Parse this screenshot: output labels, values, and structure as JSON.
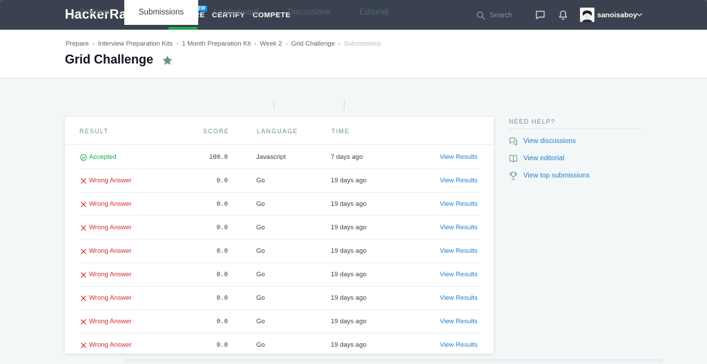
{
  "nav": {
    "logo": "HackerRank",
    "links": [
      "PREPARE",
      "CERTIFY",
      "COMPETE"
    ],
    "new_badge": "NEW",
    "search_placeholder": "Search",
    "username": "sanoisaboy"
  },
  "breadcrumb": [
    "Prepare",
    "Interview Preparation Kits",
    "1 Month Preparation Kit",
    "Week 2",
    "Grid Challenge",
    "Submissions"
  ],
  "page_title": "Grid Challenge",
  "tabs": [
    "Problem",
    "Submissions",
    "Leaderboard",
    "Discussions",
    "Editorial"
  ],
  "table": {
    "headers": [
      "RESULT",
      "SCORE",
      "LANGUAGE",
      "TIME"
    ],
    "rows": [
      {
        "result": "Accepted",
        "score": "100.0",
        "language": "Javascript",
        "time": "7 days ago",
        "action": "View Results"
      },
      {
        "result": "Wrong Answer",
        "score": "0.0",
        "language": "Go",
        "time": "19 days ago",
        "action": "View Results"
      },
      {
        "result": "Wrong Answer",
        "score": "0.0",
        "language": "Go",
        "time": "19 days ago",
        "action": "View Results"
      },
      {
        "result": "Wrong Answer",
        "score": "0.0",
        "language": "Go",
        "time": "19 days ago",
        "action": "View Results"
      },
      {
        "result": "Wrong Answer",
        "score": "0.0",
        "language": "Go",
        "time": "19 days ago",
        "action": "View Results"
      },
      {
        "result": "Wrong Answer",
        "score": "0.0",
        "language": "Go",
        "time": "19 days ago",
        "action": "View Results"
      },
      {
        "result": "Wrong Answer",
        "score": "0.0",
        "language": "Go",
        "time": "19 days ago",
        "action": "View Results"
      },
      {
        "result": "Wrong Answer",
        "score": "0.0",
        "language": "Go",
        "time": "19 days ago",
        "action": "View Results"
      },
      {
        "result": "Wrong Answer",
        "score": "0.0",
        "language": "Go",
        "time": "19 days ago",
        "action": "View Results"
      }
    ]
  },
  "help": {
    "title": "NEED HELP?",
    "items": [
      "View discussions",
      "View editorial",
      "View top submissions"
    ]
  },
  "colors": {
    "nav_bg": "#39424e",
    "brand_green": "#1ba94c",
    "link_blue": "#1f7ed0",
    "error_red": "#d52d2d"
  }
}
